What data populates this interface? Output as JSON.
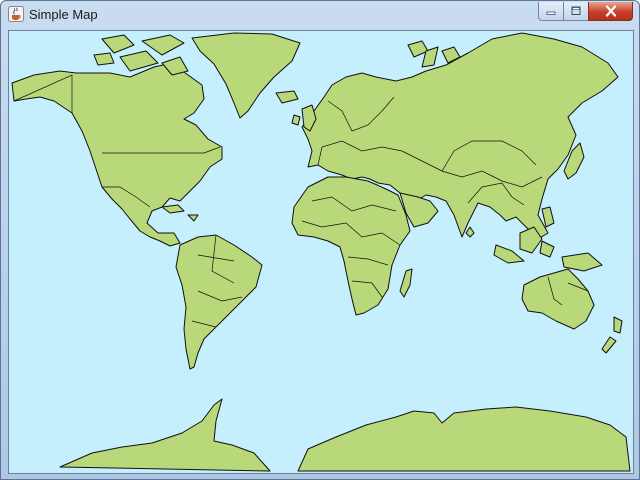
{
  "window": {
    "title": "Simple Map",
    "app_icon": "java-cup-icon",
    "controls": {
      "minimize_icon": "minimize-icon",
      "maximize_icon": "maximize-icon",
      "close_icon": "close-icon"
    }
  },
  "map": {
    "projection": "mercator",
    "colors": {
      "ocean": "#c5effd",
      "land": "#b8d879",
      "outline": "#101010"
    }
  }
}
